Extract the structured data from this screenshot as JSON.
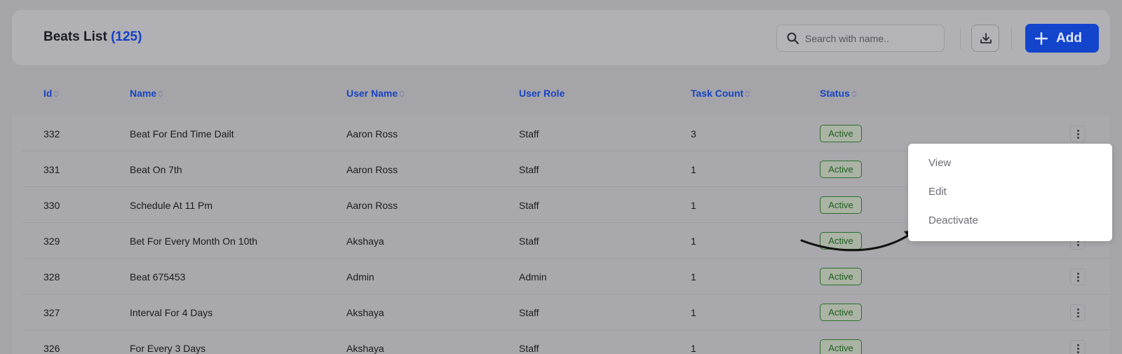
{
  "header": {
    "title": "Beats List",
    "count": "(125)",
    "search_placeholder": "Search with name..",
    "add_label": "Add"
  },
  "columns": [
    "Id",
    "Name",
    "User Name",
    "User Role",
    "Task Count",
    "Status"
  ],
  "rows": [
    {
      "id": "332",
      "name": "Beat For End Time Dailt",
      "user_name": "Aaron Ross",
      "role": "Staff",
      "task_count": "3",
      "status": "Active"
    },
    {
      "id": "331",
      "name": "Beat On 7th",
      "user_name": "Aaron Ross",
      "role": "Staff",
      "task_count": "1",
      "status": "Active"
    },
    {
      "id": "330",
      "name": "Schedule At 11 Pm",
      "user_name": "Aaron Ross",
      "role": "Staff",
      "task_count": "1",
      "status": "Active"
    },
    {
      "id": "329",
      "name": "Bet For Every Month On 10th",
      "user_name": "Akshaya",
      "role": "Staff",
      "task_count": "1",
      "status": "Active"
    },
    {
      "id": "328",
      "name": "Beat 675453",
      "user_name": "Admin",
      "role": "Admin",
      "task_count": "1",
      "status": "Active"
    },
    {
      "id": "327",
      "name": "Interval For 4 Days",
      "user_name": "Akshaya",
      "role": "Staff",
      "task_count": "1",
      "status": "Active"
    },
    {
      "id": "326",
      "name": "For Every 3 Days",
      "user_name": "Akshaya",
      "role": "Staff",
      "task_count": "1",
      "status": "Active"
    }
  ],
  "context_menu": {
    "items": [
      "View",
      "Edit",
      "Deactivate"
    ]
  },
  "colors": {
    "accent": "#1244cc",
    "active_badge": "#2d6f2d"
  }
}
